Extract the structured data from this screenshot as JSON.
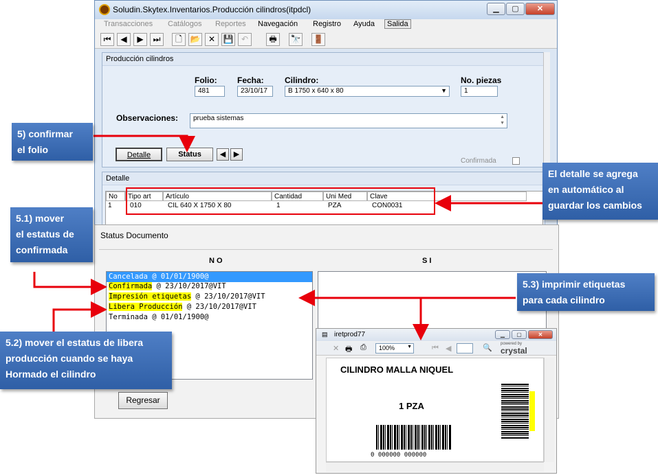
{
  "window": {
    "title": "Soludin.Skytex.Inventarios.Producción cilindros(itpdcl)"
  },
  "menu": [
    "Transacciones",
    "Catálogos",
    "Reportes",
    "Navegación",
    "Registro",
    "Ayuda",
    "Salida"
  ],
  "produccion": {
    "panel_title": "Producción cilindros",
    "folio_label": "Folio:",
    "folio_value": "481",
    "fecha_label": "Fecha:",
    "fecha_value": "23/10/17",
    "cilindro_label": "Cilindro:",
    "cilindro_value": "B 1750 x 640 x 80",
    "piezas_label": "No. piezas",
    "piezas_value": "1",
    "observaciones_label": "Observaciones:",
    "observaciones_value": "prueba sistemas",
    "detalle_button": "Detalle",
    "status_button": "Status",
    "confirmada_label": "Confirmada"
  },
  "detalle": {
    "panel_title": "Detalle",
    "columns": [
      "No",
      "Tipo art",
      "Artículo",
      "Cantidad",
      "Uni Med",
      "Clave"
    ],
    "rows": [
      [
        "1",
        "010",
        "CIL 640 X 1750 X 80",
        "1",
        "PZA",
        "CON0031"
      ]
    ]
  },
  "status_dialog": {
    "title": "Status Documento",
    "no_header": "N O",
    "si_header": "S I",
    "no_items": [
      {
        "label": "Cancelada",
        "suffix": " @ 01/01/1900@"
      },
      {
        "label": "Confirmada",
        "suffix": " @ 23/10/2017@VIT"
      },
      {
        "label": "Impresión etiquetas",
        "suffix": " @ 23/10/2017@VIT"
      },
      {
        "label": "Libera Producción",
        "suffix": " @ 23/10/2017@VIT"
      },
      {
        "label": "Terminada",
        "suffix": " @ 01/01/1900@"
      }
    ],
    "regresar_button": "Regresar"
  },
  "crystal": {
    "title": "iretprod77",
    "zoom": "100%",
    "brand_small": "powered by",
    "brand": "crystal",
    "label_title": "CILINDRO MALLA NIQUEL",
    "label_qty": "1 PZA",
    "barcode_text": "0 000000 000000"
  },
  "callouts": {
    "c5": [
      "5) confirmar",
      "el folio"
    ],
    "c_detalle": [
      "El detalle se agrega",
      "en automático al",
      "guardar los cambios"
    ],
    "c51": [
      "5.1) mover",
      "el estatus de",
      "confirmada"
    ],
    "c53": [
      "5.3) imprimir etiquetas",
      "para cada cilindro"
    ],
    "c52": [
      "5.2) mover el estatus de libera",
      "producción cuando se haya",
      "Hormado el cilindro"
    ]
  },
  "colors": {
    "callout_bg": "#3d6eb8",
    "annotation_red": "#e8000b",
    "highlight": "#ffff00",
    "selection": "#3399ff"
  }
}
